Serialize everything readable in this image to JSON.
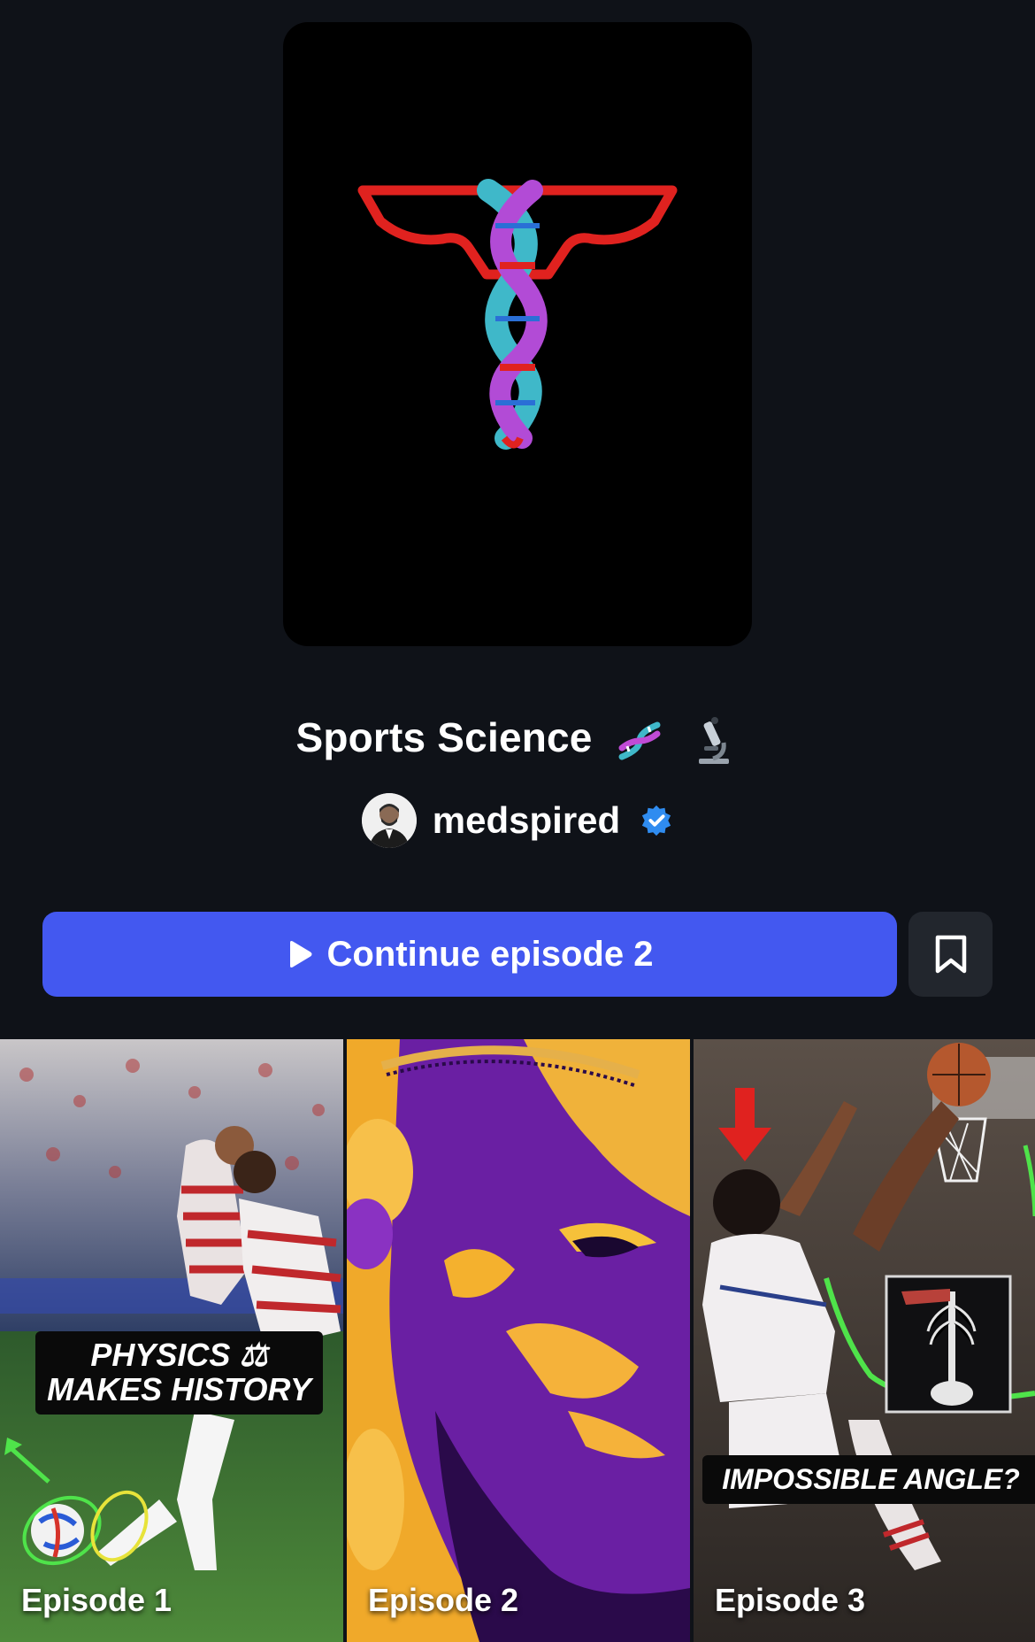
{
  "series": {
    "title": "Sports Science",
    "title_emojis": [
      "dna-icon",
      "microscope-icon"
    ],
    "author": "medspired",
    "author_verified": true
  },
  "actions": {
    "continue_label": "Continue episode 2",
    "play_icon": "play-icon",
    "bookmark_icon": "bookmark-icon"
  },
  "episodes": [
    {
      "label": "Episode 1",
      "caption": "PHYSICS ⚖ MAKES HISTORY"
    },
    {
      "label": "Episode 2",
      "caption": ""
    },
    {
      "label": "Episode 3",
      "caption": "IMPOSSIBLE ANGLE?"
    }
  ],
  "colors": {
    "background": "#0f1218",
    "accent_button": "#4358f0",
    "secondary_button": "#22262d",
    "verified_badge": "#2f8cf0",
    "logo_red": "#e0221f",
    "logo_teal": "#3fb8c9",
    "logo_purple": "#b24bd6"
  }
}
